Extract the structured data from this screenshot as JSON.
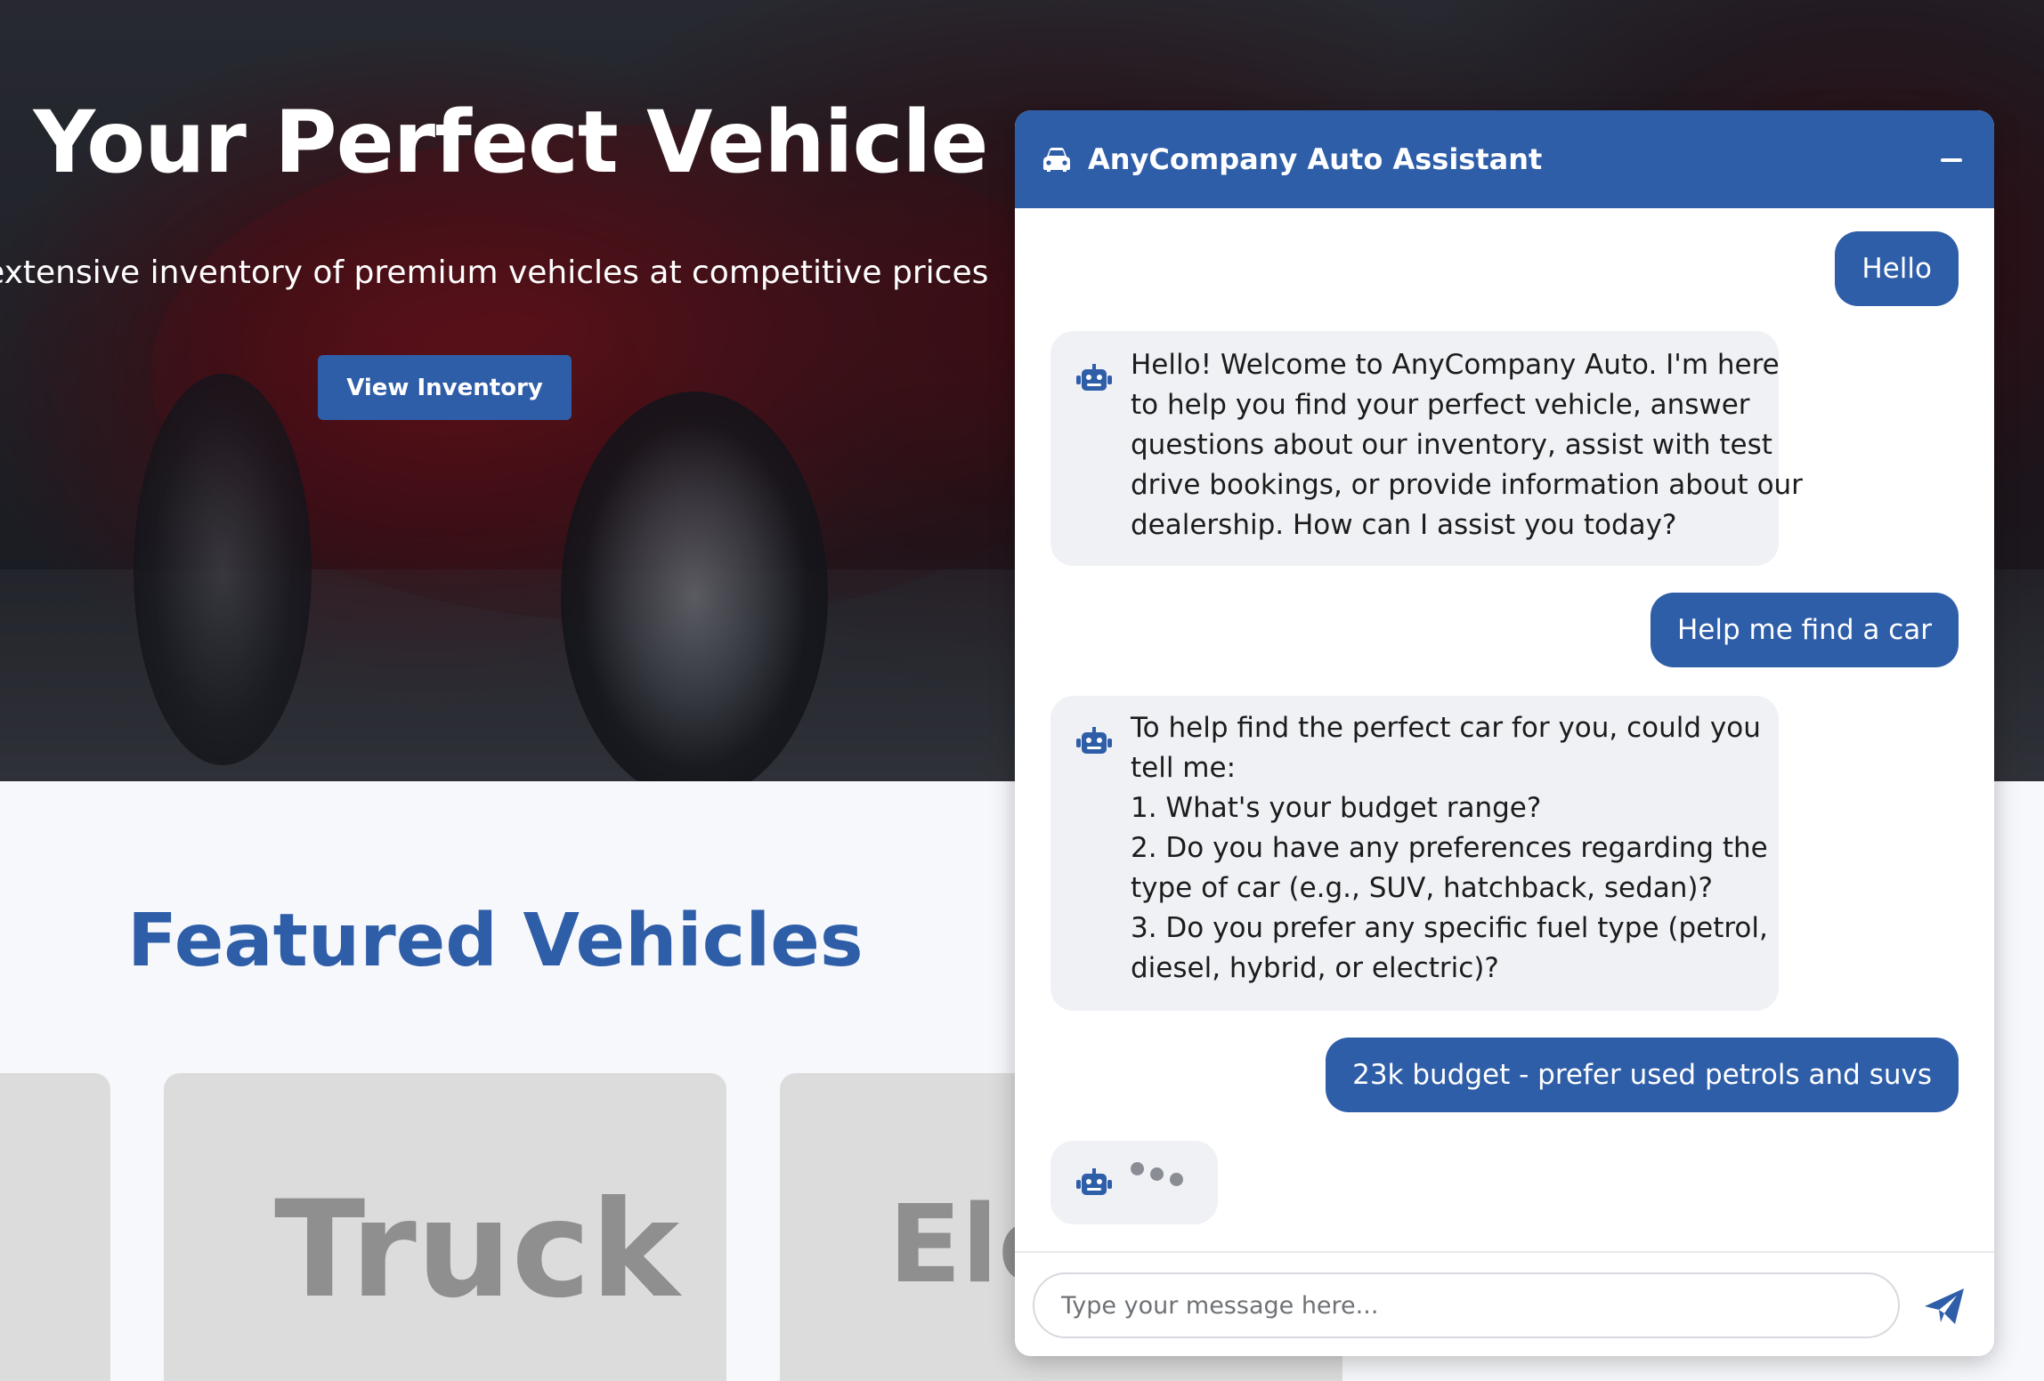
{
  "hero": {
    "title": "nd Your Perfect Vehicle",
    "subtitle": "our extensive inventory of premium vehicles at competitive prices",
    "cta_label": "View Inventory"
  },
  "featured": {
    "title": "Featured Vehicles",
    "cards": [
      {
        "label": ""
      },
      {
        "label": "Truck"
      },
      {
        "label": "Ele"
      }
    ]
  },
  "chat": {
    "title": "AnyCompany Auto Assistant",
    "header_icon": "car-icon",
    "minimize_icon": "minimize-icon",
    "messages": [
      {
        "role": "user",
        "text": "Hello"
      },
      {
        "role": "bot",
        "text": "Hello! Welcome to AnyCompany Auto. I'm here\nto help you find your perfect vehicle, answer\nquestions about our inventory, assist with test\ndrive bookings, or provide information about our\ndealership. How can I assist you today?"
      },
      {
        "role": "user",
        "text": "Help me find a car"
      },
      {
        "role": "bot",
        "text": "To help find the perfect car for you, could you\ntell me:\n1. What's your budget range?\n2. Do you have any preferences regarding the\ntype of car (e.g., SUV, hatchback, sedan)?\n3. Do you prefer any specific fuel type (petrol,\ndiesel, hybrid, or electric)?"
      },
      {
        "role": "user",
        "text": "23k budget - prefer used petrols and suvs"
      },
      {
        "role": "bot",
        "typing": true
      }
    ],
    "input": {
      "placeholder": "Type your message here...",
      "value": ""
    },
    "send_icon": "send-icon",
    "bot_icon": "robot-icon"
  },
  "colors": {
    "brand_blue": "#2f5ea8",
    "bot_bubble": "#eff1f5",
    "card_gray": "#dcdcdc"
  }
}
